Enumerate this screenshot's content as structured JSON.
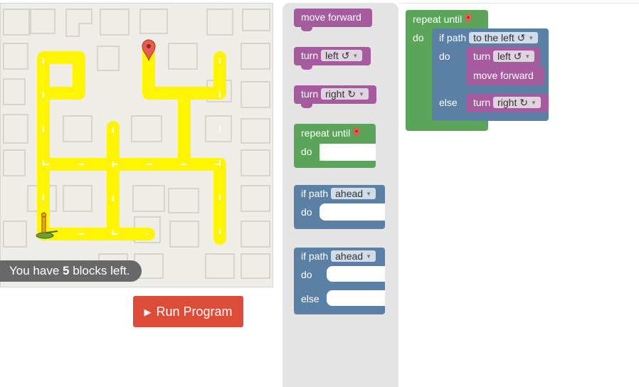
{
  "capacity": {
    "prefix": "You have ",
    "count": "5",
    "suffix": " blocks left."
  },
  "run_button": {
    "label": "Run Program",
    "icon": "play-icon"
  },
  "toolbox": {
    "move_forward": "move forward",
    "turn_left": {
      "label": "turn",
      "option": "left ↺"
    },
    "turn_right": {
      "label": "turn",
      "option": "right ↻"
    },
    "repeat_until": {
      "label": "repeat until",
      "do": "do"
    },
    "if_path": {
      "label": "if path",
      "option": "ahead",
      "do": "do"
    },
    "if_else": {
      "label": "if path",
      "option": "ahead",
      "do": "do",
      "else": "else"
    }
  },
  "workspace": {
    "repeat_until": "repeat until",
    "do": "do",
    "if_path": "if path",
    "if_option": "to the left ↺",
    "inner_do": "do",
    "turn_label": "turn",
    "turn_left_option": "left ↺",
    "move_forward": "move forward",
    "else": "else",
    "turn_right_option": "right ↻"
  },
  "colors": {
    "movement": "#a55b9e",
    "loop": "#5ba55b",
    "logic": "#5b80a5",
    "run": "#dd4b39",
    "path": "#fff500"
  }
}
